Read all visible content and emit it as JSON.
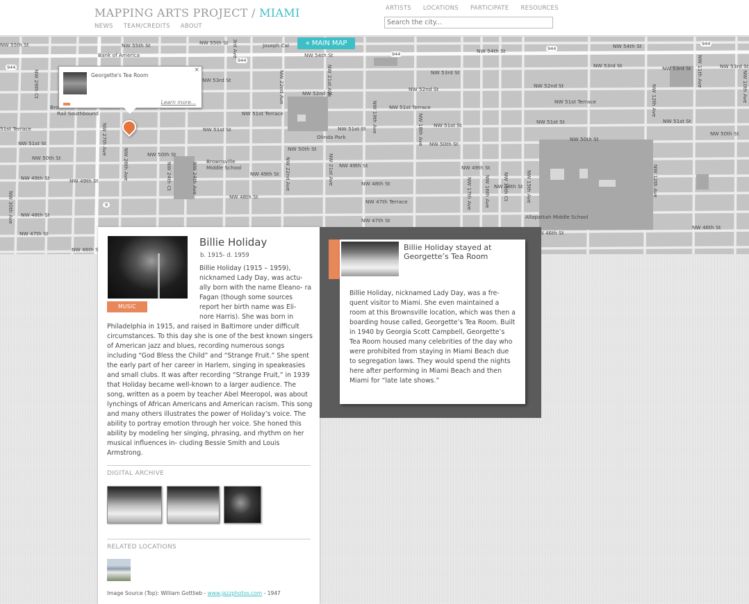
{
  "header": {
    "brand_prefix": "MAPPING ARTS PROJECT /",
    "brand_city": "MIAMI",
    "subnav": [
      "NEWS",
      "TEAM/CREDITS",
      "ABOUT"
    ],
    "topnav": [
      "ARTISTS",
      "LOCATIONS",
      "PARTICIPATE",
      "RESOURCES"
    ],
    "search_placeholder": "Search the city..."
  },
  "map": {
    "main_map_label": "« MAIN MAP",
    "popup": {
      "title": "Georgette's Tea Room",
      "close": "×",
      "learn_more": "Learn more..."
    },
    "labels": {
      "nw55": "NW 55th St",
      "bank": "Bank of America",
      "joseph": "Joseph Cal",
      "nw54a": "NW 54th St",
      "nw54b": "NW 54th St",
      "nw54c": "NW 54th St",
      "nw53a": "NW 53rd St",
      "nw53b": "NW 53rd St",
      "nw53c": "NW 53rd St",
      "nw53d": "NW 53rd St",
      "nw53e": "NW 53rd St",
      "nw52a": "NW 52nd St",
      "nw52b": "NW 52nd St",
      "nw52c": "NW 52nd St",
      "nw51tA": "NW 51st Terrace",
      "nw51tB": "NW 51st Terrace",
      "nw51tC": "NW 51st Terrace",
      "nw51tD": "51st Terrace",
      "nw51a": "NW 51st St",
      "nw51b": "NW 51st St",
      "nw51c": "NW 51st St",
      "nw51d": "NW 51st St",
      "nw51e": "NW 51st St",
      "nw51f": "NW 51st St",
      "nw50a": "NW 50th St",
      "nw50b": "NW 50th St",
      "nw50c": "NW 50th St",
      "nw50d": "NW 50th St",
      "nw50e": "NW 50th St",
      "nw50f": "NW 50th St",
      "nw49a": "NW 49th St",
      "nw49b": "NW 49th St",
      "nw49c": "NW 49th St",
      "nw49d": "NW 49th St",
      "nw49e": "NW 49th St",
      "nw48a": "NW 48th St",
      "nw48b": "NW 48th St",
      "nw48c": "NW 48th St",
      "nw48d": "NW 48th St",
      "nw47a": "NW 47th St",
      "nw47b": "NW 47th St",
      "nw47t": "NW 47th Terrace",
      "nw46a": "NW 46th St",
      "nw46b": "NW 46th St",
      "nw46c": "NW 46th St",
      "rail": "Rail Southbound",
      "brownsville_metro": "Bro",
      "brownsville_school": "Brownsville Middle School",
      "olinda": "Olinda Park",
      "allapattah": "Allapattah Middle School",
      "av22": "NW 22nd Ave",
      "av21": "NW 21st Ave",
      "av19": "NW 19th Ave",
      "av18": "NW 18th Ave",
      "av17": "NW 17th Ave",
      "av16": "NW 16th Ave",
      "av15": "NW 15th Ave",
      "av15ct": "NW 15th Ct",
      "av12": "NW 12th Ave",
      "av11": "NW 11th Ave",
      "av10": "NW 10th Ave",
      "av27": "NW 27th Ave",
      "av26": "NW 26th Ave",
      "av24": "NW 24th Ave",
      "av24ct": "NW 24th Ct",
      "av29": "NW 29th Ct",
      "av30": "NW 30th Ave",
      "av3rd": "3rd Ave",
      "hw944a": "944",
      "hw944b": "944",
      "hw944c": "944",
      "hw944d": "944",
      "hw944e": "944",
      "hw9": "9"
    }
  },
  "artist": {
    "name": "Billie Holiday",
    "dates": "b. 1915- d. 1959",
    "category": "MUSIC",
    "bio": "Billie Holiday (1915 – 1959), nicknamed Lady Day, was actu- ally born with the name Eleano- ra Fagan (though some sources report her birth name was Eli- nore Harris). She was born in Philadelphia in 1915, and raised in Baltimore under difficult circumstances. To this day she is one of the best known singers of American jazz and blues, recording numerous songs including “God Bless the Child” and “Strange Fruit.” She spent the early part of her career in Harlem, singing in speakeasies and small clubs. It was after recording “Strange Fruit,” in 1939 that Holiday became well-known to a larger audience. The song, written as a poem by teacher Abel Meeropol, was about lynchings of African Americans and American racism. This song and many others illustrates the power of Holiday’s voice. The ability to portray emotion through her voice. She honed this ability by modeling her singing, phrasing, and rhythm on her musical influences in- cluding Bessie Smith and Louis Armstrong.",
    "digital_archive_label": "DIGITAL ARCHIVE",
    "related_locations_label": "RELATED LOCATIONS",
    "image_source_prefix": "Image Source (Top): William Gottlieb -",
    "image_source_link": "www.jazzphotos.com",
    "image_source_suffix": "- 1947"
  },
  "story": {
    "title": "Billie Holiday stayed at Georgette’s Tea Room",
    "body": "Billie Holiday, nicknamed Lady Day, was a fre- quent visitor to Miami. She even maintained a room at this Brownsville location, which was then a boarding house called, Georgette’s Tea Room. Built in 1940 by Georgia Scott Campbell, Georgette’s Tea Room housed many celebrities of the day who were prohibited from staying in Miami Beach due to segregation laws. They would spend the nights here after performing in Miami Beach and then Miami for “late late shows.”"
  },
  "colors": {
    "accent_teal": "#3cbfc7",
    "accent_orange": "#e8875a",
    "pin_orange": "#e5733d",
    "dark_panel": "#5b5b5b"
  }
}
